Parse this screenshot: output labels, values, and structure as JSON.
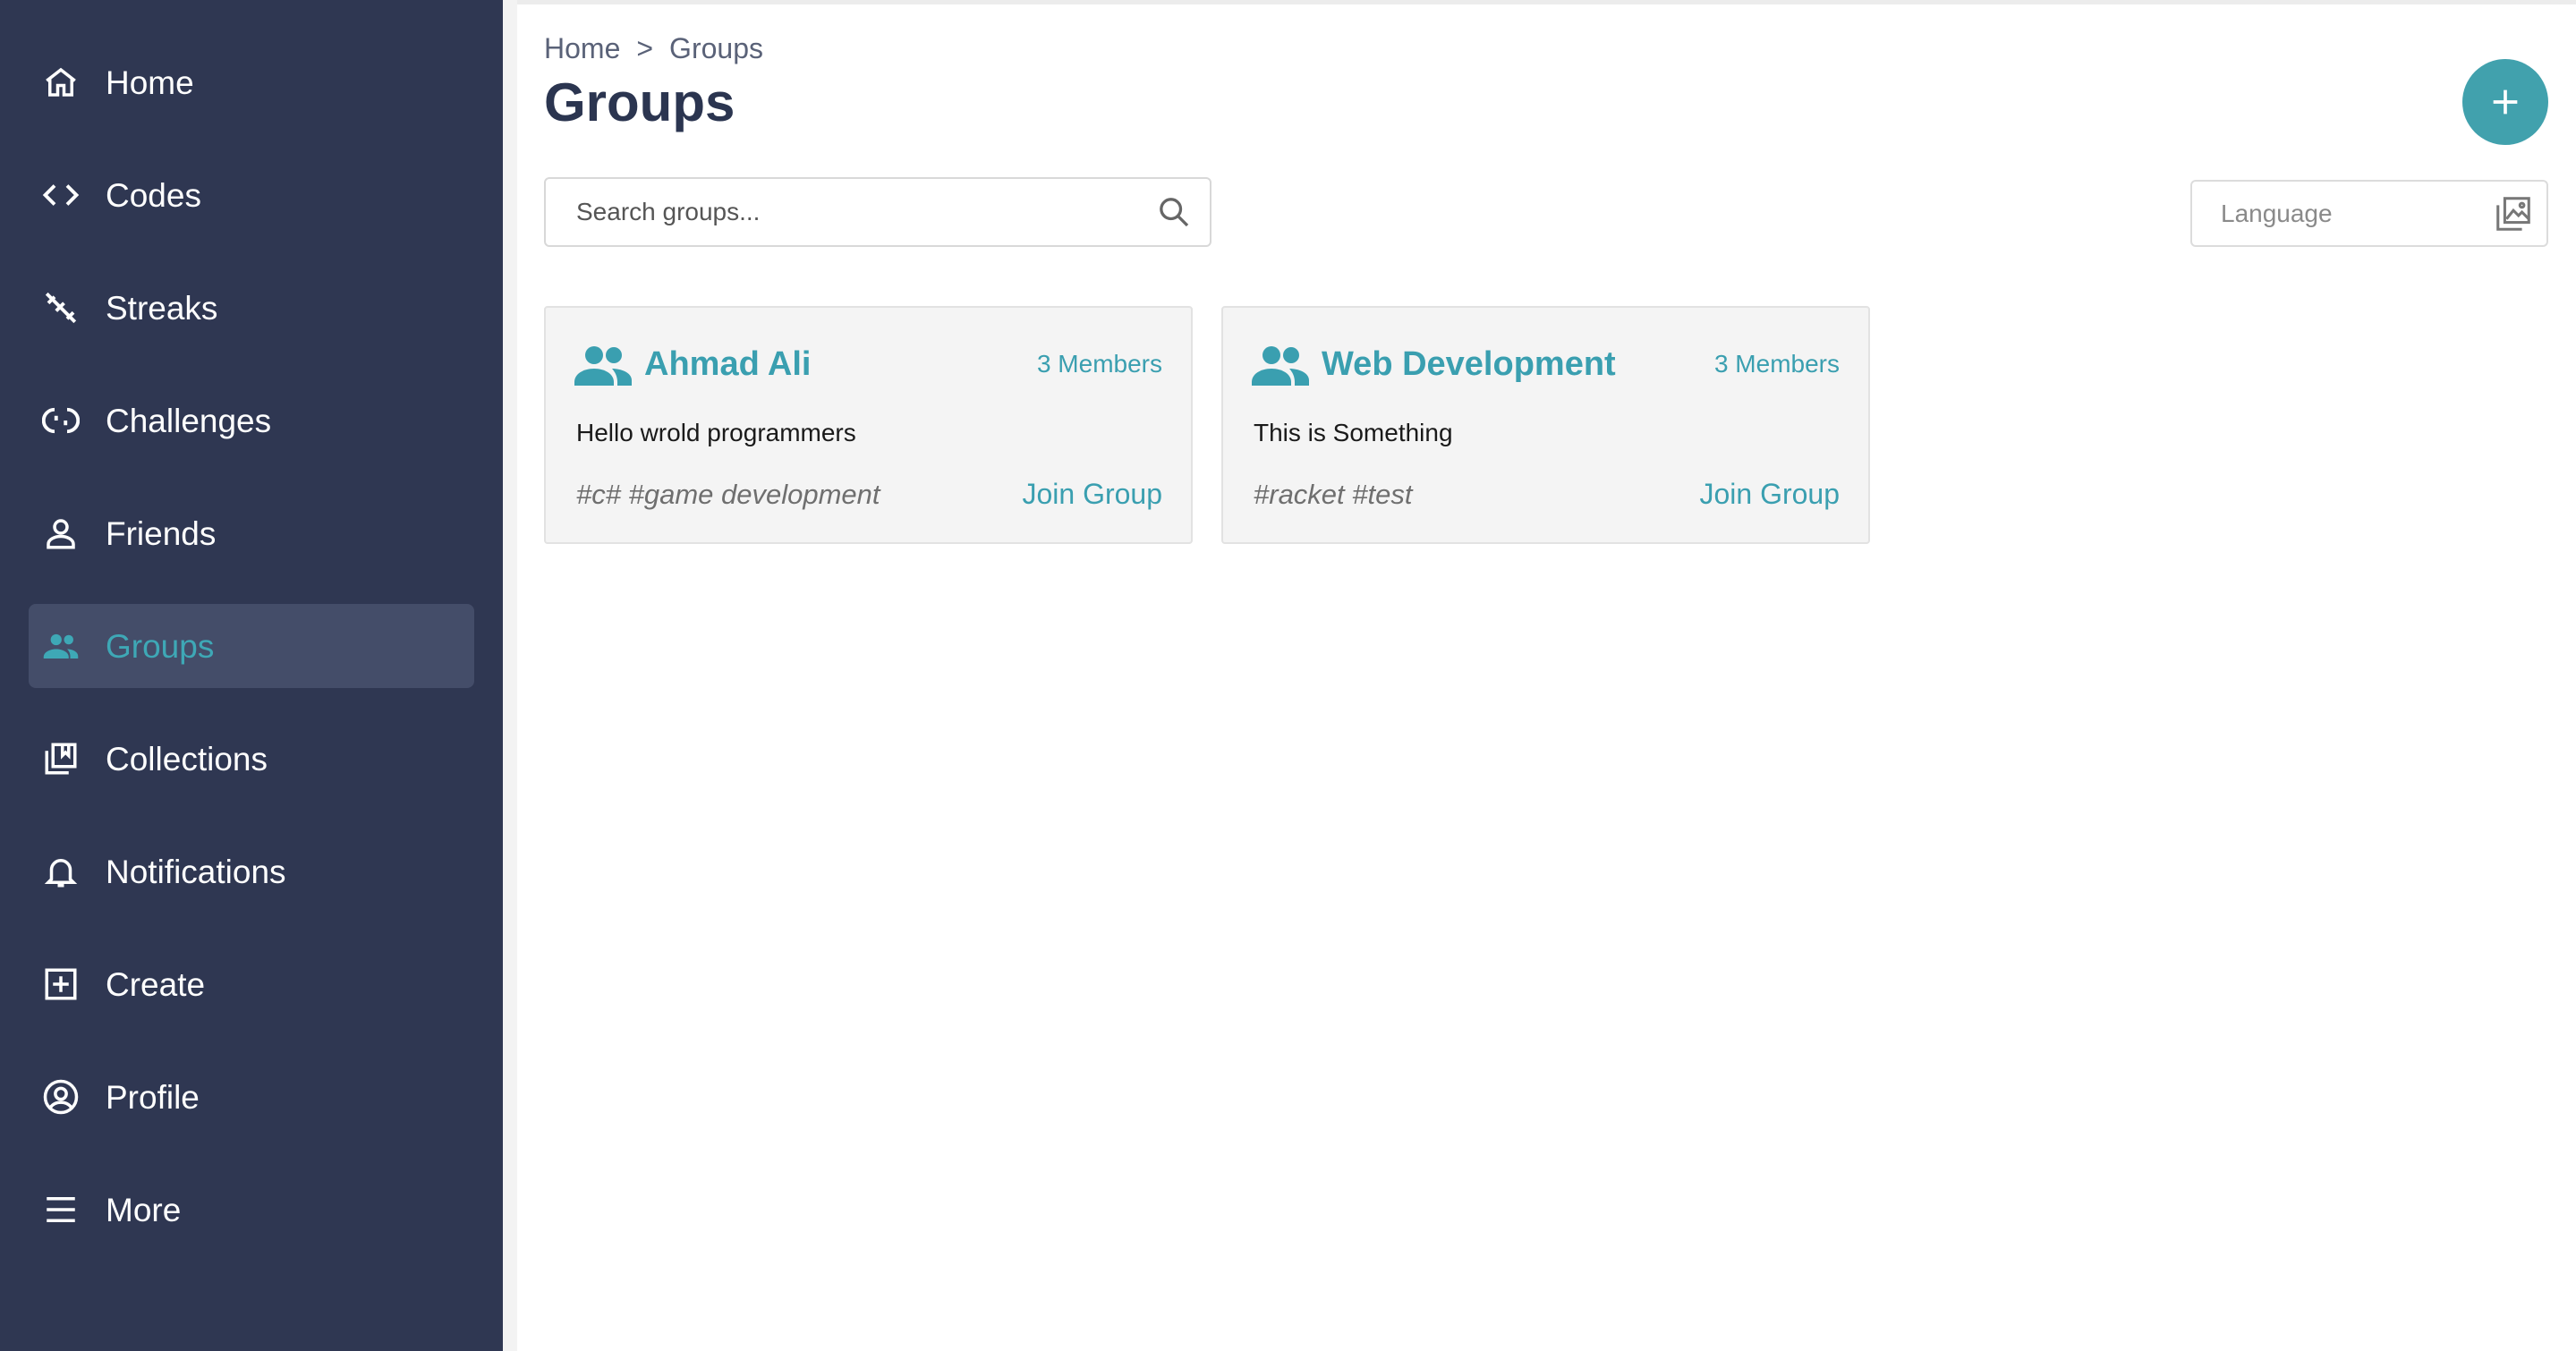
{
  "sidebar": {
    "items": [
      {
        "label": "Home",
        "icon": "home-icon"
      },
      {
        "label": "Codes",
        "icon": "code-icon"
      },
      {
        "label": "Streaks",
        "icon": "streak-off-icon"
      },
      {
        "label": "Challenges",
        "icon": "challenge-icon"
      },
      {
        "label": "Friends",
        "icon": "person-icon"
      },
      {
        "label": "Groups",
        "icon": "group-icon",
        "active": true
      },
      {
        "label": "Collections",
        "icon": "collections-icon"
      },
      {
        "label": "Notifications",
        "icon": "bell-icon"
      },
      {
        "label": "Create",
        "icon": "add-box-icon"
      },
      {
        "label": "Profile",
        "icon": "profile-circle-icon"
      },
      {
        "label": "More",
        "icon": "menu-icon"
      }
    ]
  },
  "breadcrumb": {
    "home": "Home",
    "separator": ">",
    "current": "Groups"
  },
  "page": {
    "title": "Groups"
  },
  "fab": {
    "icon": "plus-icon"
  },
  "search": {
    "placeholder": "Search groups...",
    "value": ""
  },
  "language": {
    "placeholder": "Language",
    "icon": "image-stack-icon"
  },
  "groups": [
    {
      "name": "Ahmad Ali",
      "members": "3 Members",
      "description": "Hello wrold programmers",
      "tags": "#c# #game development",
      "action": "Join Group"
    },
    {
      "name": "Web Development",
      "members": "3 Members",
      "description": "This is Something",
      "tags": "#racket #test",
      "action": "Join Group"
    }
  ],
  "colors": {
    "sidebar_bg": "#2f3752",
    "sidebar_active_bg": "#444d69",
    "accent": "#3a9fb0",
    "title": "#2b3550"
  }
}
